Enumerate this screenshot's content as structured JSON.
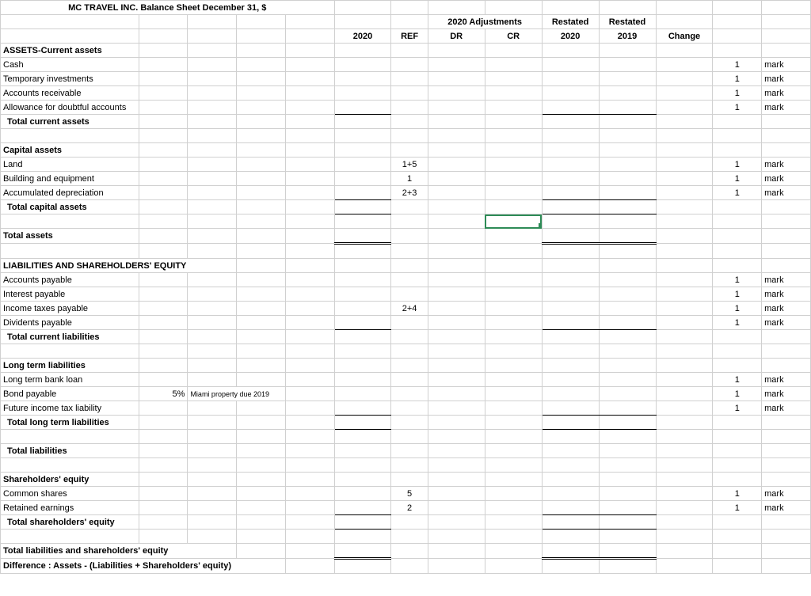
{
  "title": "MC TRAVEL INC. Balance Sheet December 31, $",
  "headers": {
    "adjustments": "2020 Adjustments",
    "restated1": "Restated",
    "restated2": "Restated",
    "y2020": "2020",
    "ref": "REF",
    "dr": "DR",
    "cr": "CR",
    "r2020": "2020",
    "r2019": "2019",
    "change": "Change"
  },
  "sections": {
    "assets_current": "ASSETS-Current assets",
    "cash": "Cash",
    "temp_inv": "Temporary investments",
    "ar": "Accounts receivable",
    "allowance": "Allowance for doubtful accounts",
    "total_current_assets": "Total current assets",
    "capital_assets": "Capital assets",
    "land": "Land",
    "building": "Building and equipment",
    "accum_dep": "Accumulated depreciation",
    "total_capital": "Total capital assets",
    "total_assets": "Total assets",
    "liab_equity": "LIABILITIES AND SHAREHOLDERS' EQUITY",
    "ap": "Accounts payable",
    "interest": "Interest payable",
    "income_tax": "Income taxes payable",
    "dividends": "Dividents payable",
    "total_current_liab": "Total current liabilities",
    "lt_liab": "Long term liabilities",
    "lt_loan": "Long term bank loan",
    "bond": "Bond payable",
    "future_tax": "Future income tax liability",
    "total_lt": "Total long term liabilities",
    "total_liab": "Total liabilities",
    "sh_equity": "Shareholders' equity",
    "common": "Common shares",
    "retained": "Retained earnings",
    "total_sh": "Total shareholders' equity",
    "total_liab_sh": "Total liabilities and shareholders' equity",
    "diff": "Difference : Assets - (Liabilities + Shareholders' equity)"
  },
  "refs": {
    "land": "1+5",
    "building": "1",
    "accum_dep": "2+3",
    "income_tax": "2+4",
    "common": "5",
    "retained": "2"
  },
  "bond_note": {
    "pct": "5%",
    "desc": "Miami property due 2019"
  },
  "mark": "mark",
  "one": "1"
}
